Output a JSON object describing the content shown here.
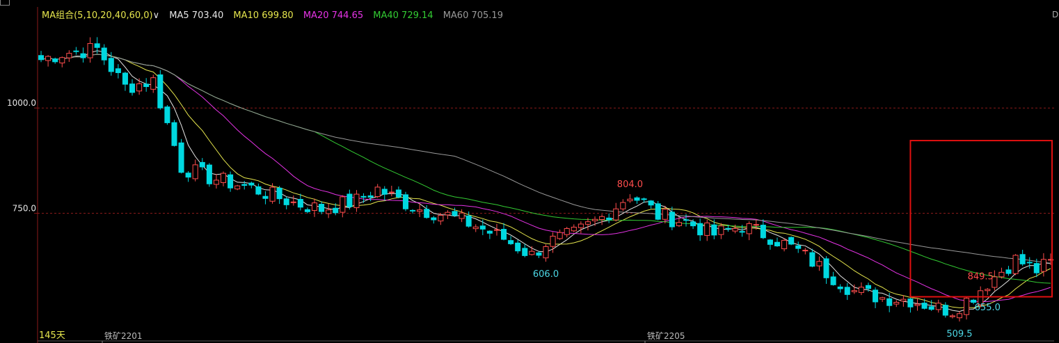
{
  "legend": {
    "ma_group": "MA组合(5,10,20,40,60,0)",
    "dropdown_glyph": "∨",
    "ma5": "MA5 703.40",
    "ma10": "MA10 699.80",
    "ma20": "MA20 744.65",
    "ma40": "MA40 729.14",
    "ma60": "MA60 705.19"
  },
  "right_edge_letter": "D",
  "period_label": "145天",
  "contract_labels": [
    "铁矿2201",
    "铁矿2205"
  ],
  "colors": {
    "up": "#ff4d4d",
    "down": "#00d8e0",
    "ma5": "#e6e6e6",
    "ma10": "#e6e64d",
    "ma20": "#e633e6",
    "ma40": "#33cc33",
    "ma60": "#999999",
    "highlight_box": "#e01010",
    "grid": "#8b1a1a",
    "label_high": "#ff4d4d",
    "label_low": "#4dd8e6"
  },
  "chart_data": {
    "type": "candlestick",
    "title": "",
    "ylabel": "",
    "ylim": [
      480,
      1220
    ],
    "y_ticks": [
      750,
      1000
    ],
    "y_tick_labels": [
      "750.0",
      "1000.0"
    ],
    "grid": "dashed horizontal at tick values",
    "legend_position": "top-left",
    "candle_count": 145,
    "price_path_keypoints": [
      [
        0,
        1115
      ],
      [
        3,
        1130
      ],
      [
        8,
        1140
      ],
      [
        12,
        1050
      ],
      [
        16,
        1065
      ],
      [
        20,
        860
      ],
      [
        24,
        835
      ],
      [
        30,
        810
      ],
      [
        36,
        775
      ],
      [
        40,
        760
      ],
      [
        45,
        780
      ],
      [
        48,
        808
      ],
      [
        50,
        790
      ],
      [
        54,
        760
      ],
      [
        58,
        745
      ],
      [
        62,
        720
      ],
      [
        66,
        690
      ],
      [
        70,
        650
      ],
      [
        72,
        680
      ],
      [
        76,
        700
      ],
      [
        80,
        740
      ],
      [
        84,
        795
      ],
      [
        86,
        775
      ],
      [
        88,
        745
      ],
      [
        92,
        730
      ],
      [
        96,
        700
      ],
      [
        100,
        720
      ],
      [
        104,
        695
      ],
      [
        108,
        660
      ],
      [
        112,
        610
      ],
      [
        116,
        565
      ],
      [
        120,
        550
      ],
      [
        124,
        545
      ],
      [
        128,
        525
      ],
      [
        130,
        520
      ],
      [
        133,
        555
      ],
      [
        136,
        600
      ],
      [
        139,
        640
      ],
      [
        142,
        615
      ],
      [
        145,
        640
      ]
    ],
    "annotations": [
      {
        "text": "606.0",
        "kind": "low"
      },
      {
        "text": "804.0",
        "kind": "high"
      },
      {
        "text": "509.5",
        "kind": "low"
      },
      {
        "text": "849.5",
        "kind": "high"
      },
      {
        "text": "655.0",
        "kind": "low"
      }
    ],
    "moving_averages": [
      {
        "name": "MA5",
        "period": 5,
        "value": 703.4
      },
      {
        "name": "MA10",
        "period": 10,
        "value": 699.8
      },
      {
        "name": "MA20",
        "period": 20,
        "value": 744.65
      },
      {
        "name": "MA40",
        "period": 40,
        "value": 729.14
      },
      {
        "name": "MA60",
        "period": 60,
        "value": 705.19
      }
    ],
    "highlight": "last 20 candles"
  }
}
